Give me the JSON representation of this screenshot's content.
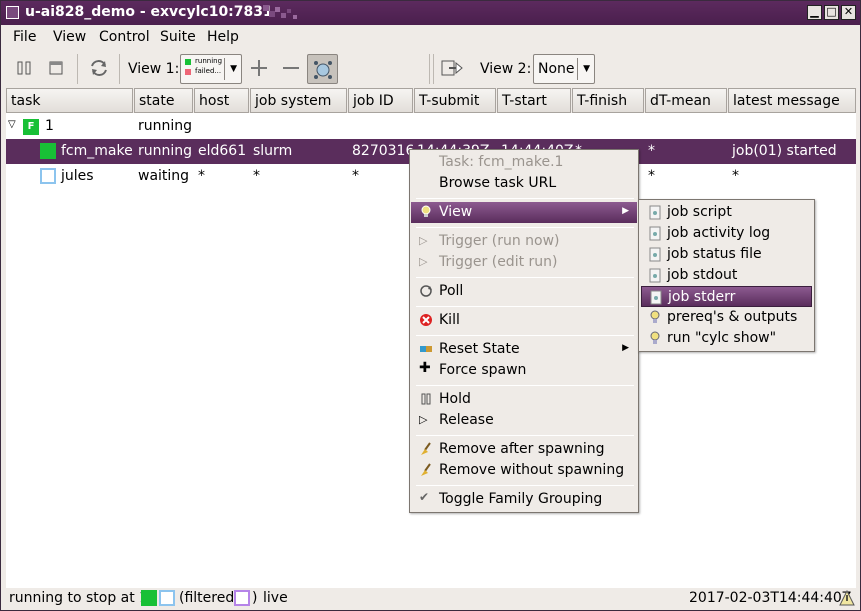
{
  "window": {
    "title": "u-ai828_demo - exvcylc10:7831"
  },
  "menubar": {
    "items": [
      {
        "label": "File",
        "key": "F"
      },
      {
        "label": "View",
        "key": "V"
      },
      {
        "label": "Control",
        "key": "C"
      },
      {
        "label": "Suite",
        "key": "S"
      },
      {
        "label": "Help",
        "key": "H"
      }
    ]
  },
  "toolbar": {
    "view1_label": "View 1:",
    "view1_icon_running": "running",
    "view1_icon_failed": "failed...",
    "view2_label": "View 2:",
    "view2_value": "None"
  },
  "table": {
    "columns": [
      "task",
      "state",
      "host",
      "job system",
      "job ID",
      "T-submit",
      "T-start",
      "T-finish",
      "dT-mean",
      "latest message"
    ],
    "family": {
      "badge": "F",
      "name": "1",
      "state": "running"
    },
    "rows": [
      {
        "task": "fcm_make",
        "state": "running",
        "host": "eld661",
        "job_system": "slurm",
        "job_id": "8270316",
        "t_submit": "14:44:39Z",
        "t_start": "14:44:40Z",
        "t_finish": "*",
        "dt_mean": "*",
        "latest_message": "job(01) started",
        "color": "#18c036",
        "selected": true
      },
      {
        "task": "jules",
        "state": "waiting",
        "host": "*",
        "job_system": "*",
        "job_id": "*",
        "t_submit": "",
        "t_start": "",
        "t_finish": "",
        "dt_mean": "*",
        "latest_message": "*",
        "color": "#8cc4ee",
        "selected": false
      }
    ]
  },
  "context_menu": {
    "task_title": "Task: fcm_make.1",
    "browse": "Browse task URL",
    "view": "View",
    "trigger_now": "Trigger (run now)",
    "trigger_edit": "Trigger (edit run)",
    "poll": "Poll",
    "kill": "Kill",
    "reset_state": "Reset State",
    "force_spawn": "Force spawn",
    "hold": "Hold",
    "release": "Release",
    "remove_after": "Remove after spawning",
    "remove_without": "Remove without spawning",
    "toggle_family": "Toggle Family Grouping"
  },
  "view_submenu": {
    "items": [
      "job script",
      "job activity log",
      "job status file",
      "job stdout",
      "job stderr",
      "prereq's & outputs",
      "run \"cylc show\""
    ],
    "highlighted": "job stderr"
  },
  "statusbar": {
    "run_text": "running to stop at 1",
    "filtered_label": "(filtered:",
    "filtered_close": ")",
    "live": "live",
    "timestamp": "2017-02-03T14:44:40Z"
  },
  "colors": {
    "accent": "#5a2d5c",
    "running": "#18c036",
    "waiting": "#8cc4ee",
    "filter": "#b584e8"
  }
}
